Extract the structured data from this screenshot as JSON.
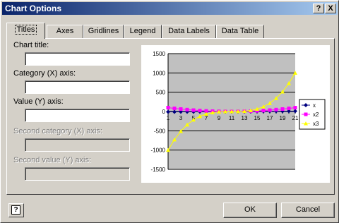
{
  "window": {
    "title": "Chart Options",
    "help_btn": "?",
    "close_btn": "X"
  },
  "tabs": [
    {
      "label": "Titles",
      "active": true
    },
    {
      "label": "Axes",
      "active": false
    },
    {
      "label": "Gridlines",
      "active": false
    },
    {
      "label": "Legend",
      "active": false
    },
    {
      "label": "Data Labels",
      "active": false
    },
    {
      "label": "Data Table",
      "active": false
    }
  ],
  "fields": [
    {
      "label": "Chart title:",
      "value": "",
      "enabled": true
    },
    {
      "label": "Category (X) axis:",
      "value": "",
      "enabled": true
    },
    {
      "label": "Value (Y) axis:",
      "value": "",
      "enabled": true
    },
    {
      "label": "Second category (X) axis:",
      "value": "",
      "enabled": false
    },
    {
      "label": "Second value (Y) axis:",
      "value": "",
      "enabled": false
    }
  ],
  "buttons": {
    "help": "?",
    "ok": "OK",
    "cancel": "Cancel"
  },
  "chart_data": {
    "type": "line",
    "title": "",
    "xlabel": "",
    "ylabel": "",
    "x": [
      1,
      2,
      3,
      4,
      5,
      6,
      7,
      8,
      9,
      10,
      11,
      12,
      13,
      14,
      15,
      16,
      17,
      18,
      19,
      20,
      21
    ],
    "x_ticks": [
      "1",
      "3",
      "5",
      "7",
      "9",
      "11",
      "13",
      "15",
      "17",
      "19",
      "21"
    ],
    "ylim": [
      -1500,
      1500
    ],
    "y_ticks": [
      "1500",
      "1000",
      "500",
      "0",
      "-500",
      "-1000",
      "-1500"
    ],
    "grid": true,
    "legend": "right",
    "plot_background": "#c0c0c0",
    "series": [
      {
        "name": "x",
        "color": "#000080",
        "marker": "diamond",
        "values": [
          -10,
          -9,
          -8,
          -7,
          -6,
          -5,
          -4,
          -3,
          -2,
          -1,
          0,
          1,
          2,
          3,
          4,
          5,
          6,
          7,
          8,
          9,
          10
        ]
      },
      {
        "name": "x2",
        "color": "#ff00ff",
        "marker": "square",
        "values": [
          100,
          81,
          64,
          49,
          36,
          25,
          16,
          9,
          4,
          1,
          0,
          1,
          4,
          9,
          16,
          25,
          36,
          49,
          64,
          81,
          100
        ]
      },
      {
        "name": "x3",
        "color": "#ffff00",
        "marker": "triangle",
        "values": [
          -1000,
          -729,
          -512,
          -343,
          -216,
          -125,
          -64,
          -27,
          -8,
          -1,
          0,
          1,
          8,
          27,
          64,
          125,
          216,
          343,
          512,
          729,
          1000
        ]
      }
    ]
  }
}
